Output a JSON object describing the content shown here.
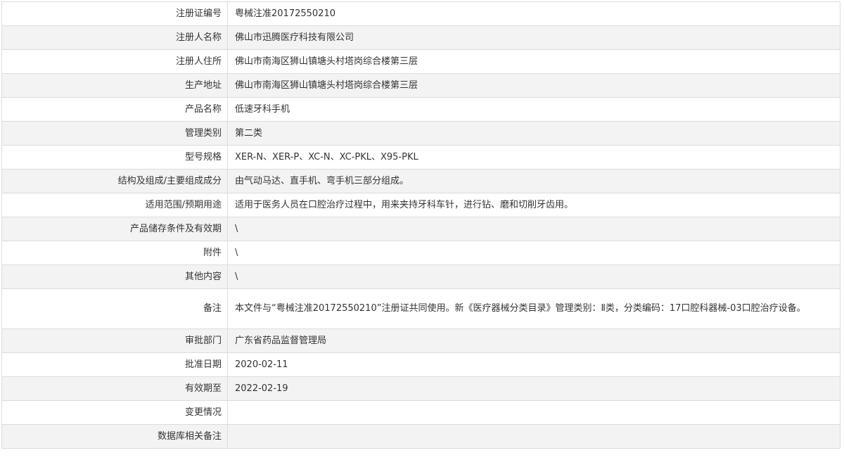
{
  "rows": [
    {
      "label": "注册证编号",
      "value": "粤械注准20172550210"
    },
    {
      "label": "注册人名称",
      "value": "佛山市迅腾医疗科技有限公司"
    },
    {
      "label": "注册人住所",
      "value": "佛山市南海区狮山镇塘头村塔岗综合楼第三层"
    },
    {
      "label": "生产地址",
      "value": "佛山市南海区狮山镇塘头村塔岗综合楼第三层"
    },
    {
      "label": "产品名称",
      "value": "低速牙科手机"
    },
    {
      "label": "管理类别",
      "value": "第二类"
    },
    {
      "label": "型号规格",
      "value": "XER-N、XER-P、XC-N、XC-PKL、X95-PKL"
    },
    {
      "label": "结构及组成/主要组成成分",
      "value": "由气动马达、直手机、弯手机三部分组成。"
    },
    {
      "label": "适用范围/预期用途",
      "value": "适用于医务人员在口腔治疗过程中，用来夹持牙科车针，进行钻、磨和切削牙齿用。"
    },
    {
      "label": "产品储存条件及有效期",
      "value": "\\"
    },
    {
      "label": "附件",
      "value": "\\"
    },
    {
      "label": "其他内容",
      "value": "\\"
    },
    {
      "label": "备注",
      "value": "本文件与“粤械注准20172550210”注册证共同使用。新《医疗器械分类目录》管理类别：Ⅱ类，分类编码：17口腔科器械-03口腔治疗设备。"
    },
    {
      "label": "审批部门",
      "value": "广东省药品监督管理局"
    },
    {
      "label": "批准日期",
      "value": "2020-02-11"
    },
    {
      "label": "有效期至",
      "value": "2022-02-19"
    },
    {
      "label": "变更情况",
      "value": ""
    },
    {
      "label": "数据库相关备注",
      "value": ""
    }
  ]
}
